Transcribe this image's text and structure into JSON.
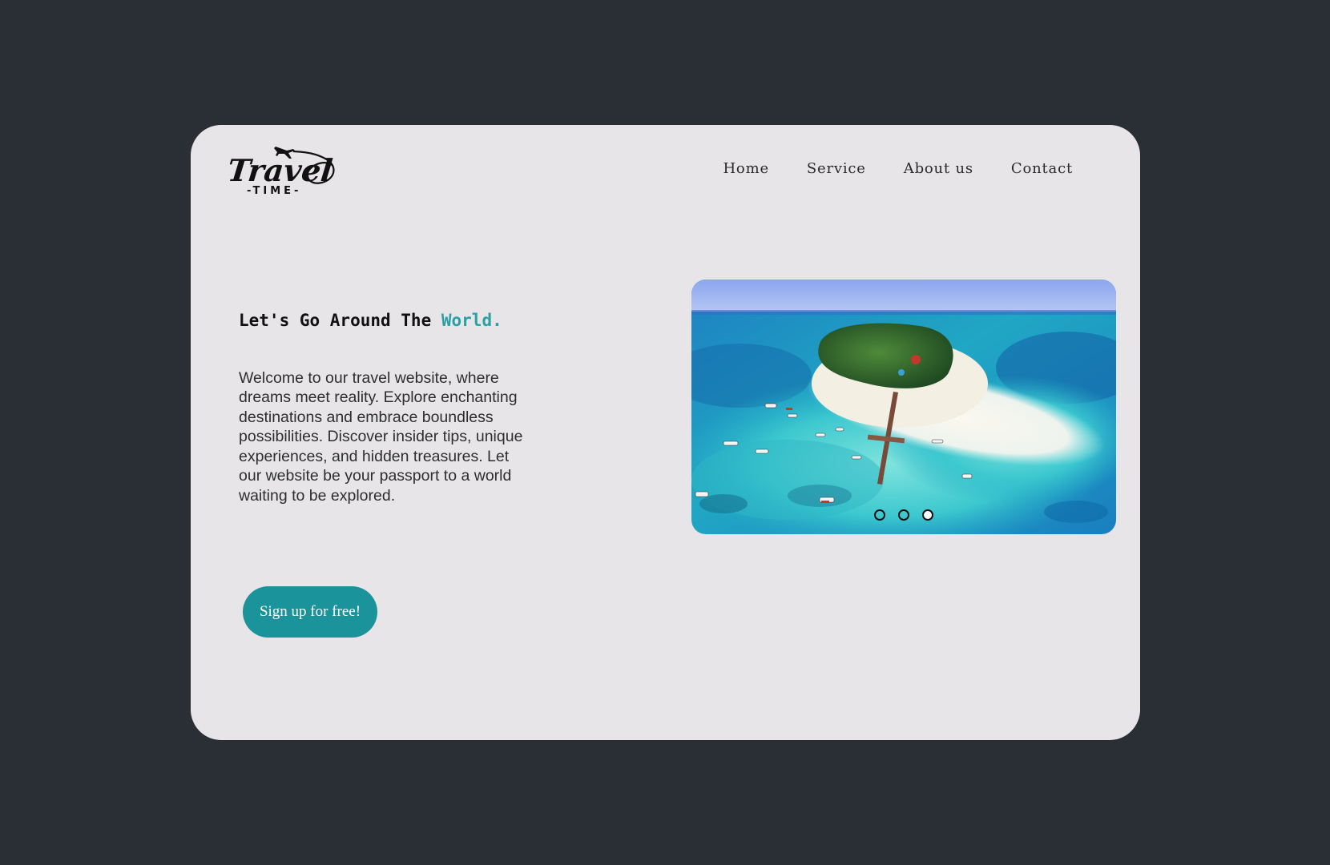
{
  "logo": {
    "wordmark": "Travel",
    "subtitle": "-TIME-"
  },
  "nav": {
    "items": [
      "Home",
      "Service",
      "About us",
      "Contact"
    ]
  },
  "hero": {
    "headline": "Let's Go Around The",
    "headline_accent": "World.",
    "paragraph": "Welcome to our travel website, where dreams meet reality. Explore enchanting destinations and embrace boundless possibilities. Discover insider tips, unique experiences, and hidden treasures. Let our website be your passport to a world waiting to be explored.",
    "cta_label": "Sign up for free!"
  },
  "slider": {
    "image": "aerial-tropical-island-photo",
    "slide_count": 3,
    "active_slide": 3
  },
  "colors": {
    "page_background": "#2a2e35",
    "card_background": "#e7e5e8",
    "accent": "#2a9fa4",
    "button": "#1a939a"
  }
}
